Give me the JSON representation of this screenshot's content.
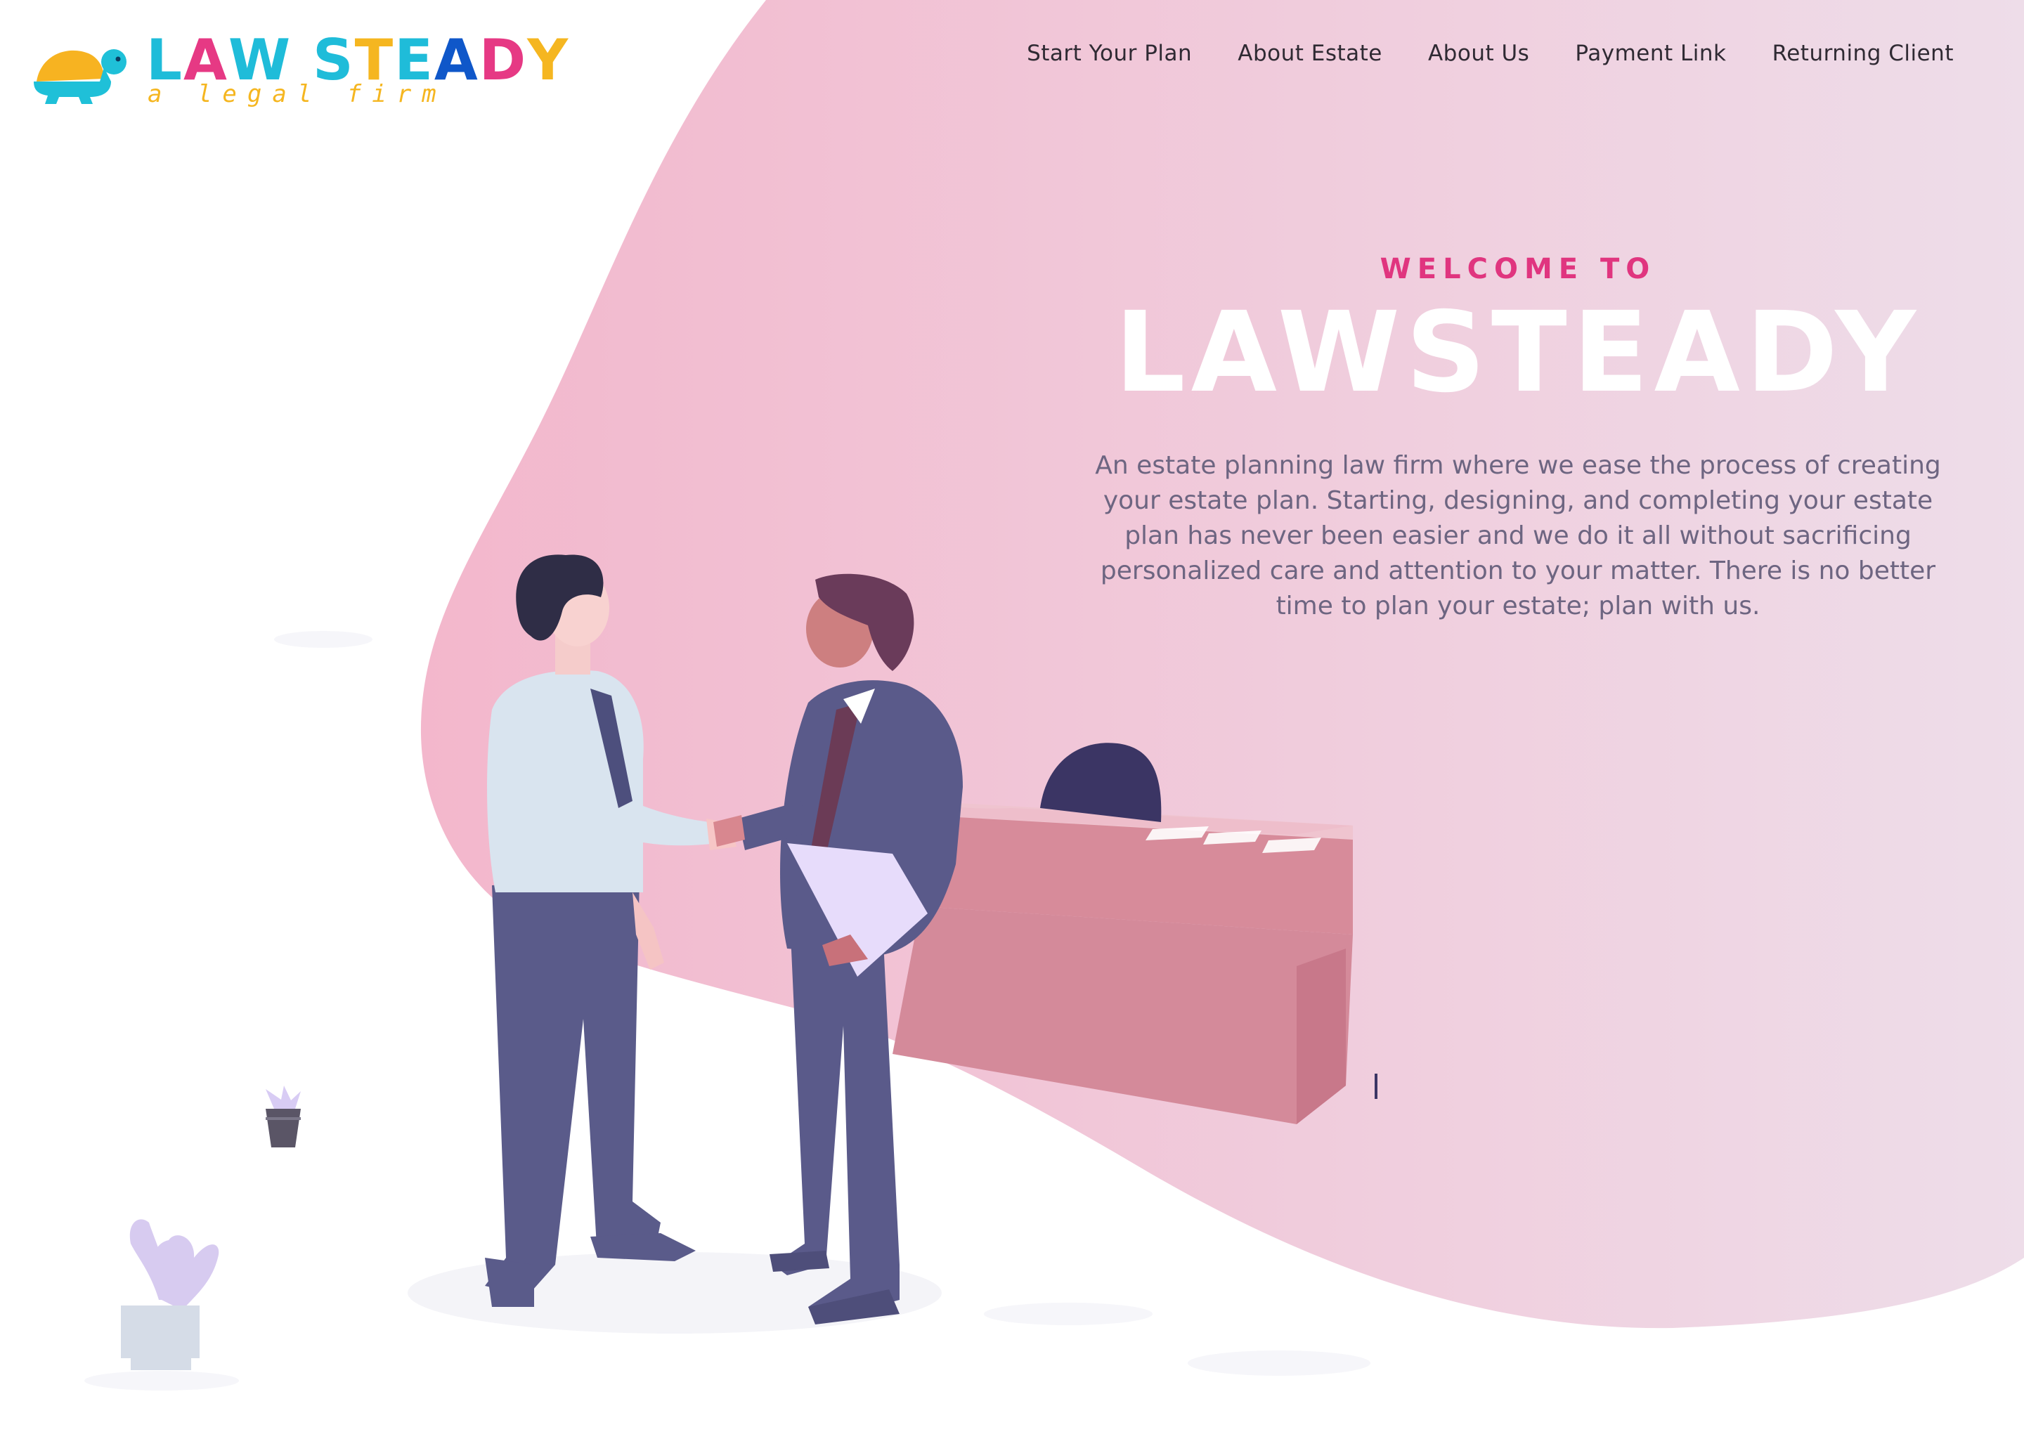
{
  "brand": {
    "logo_letters": [
      {
        "ch": "L",
        "color": "#1fbcd9"
      },
      {
        "ch": "A",
        "color": "#e63984"
      },
      {
        "ch": "W",
        "color": "#1fbcd9"
      },
      {
        "ch": " ",
        "color": "#ffffff"
      },
      {
        "ch": "S",
        "color": "#1fbcd9"
      },
      {
        "ch": "T",
        "color": "#f5b620"
      },
      {
        "ch": "E",
        "color": "#1fbcd9"
      },
      {
        "ch": "A",
        "color": "#0f57c9"
      },
      {
        "ch": "D",
        "color": "#e63984"
      },
      {
        "ch": "Y",
        "color": "#f5b620"
      }
    ],
    "tagline": "a legal firm",
    "mascot_icon": "turtle-icon"
  },
  "nav": {
    "items": [
      {
        "label": "Start Your Plan"
      },
      {
        "label": "About Estate"
      },
      {
        "label": "About Us"
      },
      {
        "label": "Payment Link"
      },
      {
        "label": "Returning Client"
      }
    ]
  },
  "hero": {
    "eyebrow": "WELCOME TO",
    "title": "LAWSTEADY",
    "description": "An estate planning law firm where we ease the process of creating your estate plan. Starting, designing, and completing your estate plan has never been easier and we do it all without sacrificing personalized care and attention to your matter. There is no better time to plan your estate; plan with us."
  },
  "colors": {
    "accent_pink": "#e0357f",
    "blob_start": "#f3b8cc",
    "blob_end": "#efdbe8",
    "desk": "#d4899a",
    "suit": "#5a5a8a"
  }
}
